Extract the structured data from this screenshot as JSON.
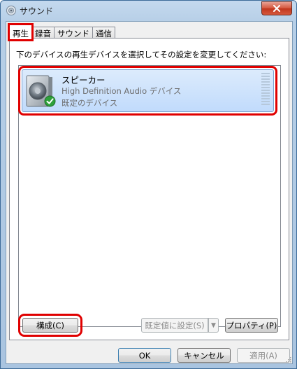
{
  "window": {
    "title": "サウンド",
    "close_glyph": "✕"
  },
  "tabs": [
    {
      "label": "再生",
      "active": true
    },
    {
      "label": "録音",
      "active": false
    },
    {
      "label": "サウンド",
      "active": false
    },
    {
      "label": "通信",
      "active": false
    }
  ],
  "panel": {
    "instruction": "下のデバイスの再生デバイスを選択してその設定を変更してください:"
  },
  "devices": [
    {
      "name": "スピーカー",
      "description": "High Definition Audio デバイス",
      "status": "既定のデバイス",
      "icon": "speaker-icon",
      "badge": "check-badge-icon",
      "selected": true
    }
  ],
  "buttons": {
    "configure": "構成(C)",
    "set_default": "既定値に設定(S)",
    "set_default_arrow": "▼",
    "properties": "プロパティ(P)",
    "ok": "OK",
    "cancel": "キャンセル",
    "apply": "適用(A)"
  },
  "colors": {
    "highlight_annotation": "#e00000",
    "selection": "#c1dbfc",
    "check_green": "#2ea03b"
  }
}
